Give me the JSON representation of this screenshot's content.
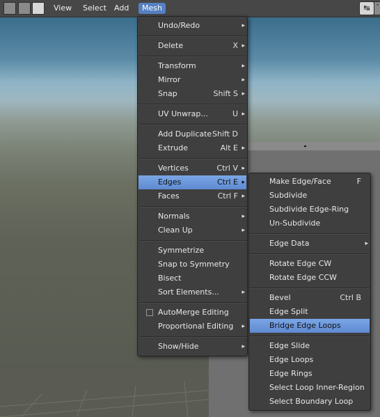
{
  "header": {
    "menus": [
      "View",
      "Select",
      "Add",
      "Mesh"
    ],
    "open_menu": "Mesh",
    "gizmo_icon": "transform-axes-icon",
    "accent_color": "#5680c2"
  },
  "mesh_menu": {
    "items": [
      {
        "label": "Undo/Redo",
        "shortcut": "",
        "submenu": true
      },
      {
        "label": "Delete",
        "shortcut": "X",
        "submenu": true
      },
      {
        "label": "Transform",
        "shortcut": "",
        "submenu": true
      },
      {
        "label": "Mirror",
        "shortcut": "",
        "submenu": true
      },
      {
        "label": "Snap",
        "shortcut": "Shift S",
        "submenu": true
      },
      {
        "label": "UV Unwrap...",
        "shortcut": "U",
        "submenu": true
      },
      {
        "label": "Add Duplicate",
        "shortcut": "Shift D",
        "submenu": false
      },
      {
        "label": "Extrude",
        "shortcut": "Alt E",
        "submenu": true
      },
      {
        "label": "Vertices",
        "shortcut": "Ctrl V",
        "submenu": true
      },
      {
        "label": "Edges",
        "shortcut": "Ctrl E",
        "submenu": true
      },
      {
        "label": "Faces",
        "shortcut": "Ctrl F",
        "submenu": true
      },
      {
        "label": "Normals",
        "shortcut": "",
        "submenu": true
      },
      {
        "label": "Clean Up",
        "shortcut": "",
        "submenu": true
      },
      {
        "label": "Symmetrize",
        "shortcut": "",
        "submenu": false
      },
      {
        "label": "Snap to Symmetry",
        "shortcut": "",
        "submenu": false
      },
      {
        "label": "Bisect",
        "shortcut": "",
        "submenu": false
      },
      {
        "label": "Sort Elements...",
        "shortcut": "",
        "submenu": true
      },
      {
        "label": "AutoMerge Editing",
        "shortcut": "",
        "submenu": false
      },
      {
        "label": "Proportional Editing",
        "shortcut": "",
        "submenu": true
      },
      {
        "label": "Show/Hide",
        "shortcut": "",
        "submenu": true
      }
    ],
    "highlighted": "Edges"
  },
  "edges_menu": {
    "items": [
      {
        "label": "Make Edge/Face",
        "shortcut": "F",
        "submenu": false
      },
      {
        "label": "Subdivide",
        "shortcut": "",
        "submenu": false
      },
      {
        "label": "Subdivide Edge-Ring",
        "shortcut": "",
        "submenu": false
      },
      {
        "label": "Un-Subdivide",
        "shortcut": "",
        "submenu": false
      },
      {
        "label": "Edge Data",
        "shortcut": "",
        "submenu": true
      },
      {
        "label": "Rotate Edge CW",
        "shortcut": "",
        "submenu": false
      },
      {
        "label": "Rotate Edge CCW",
        "shortcut": "",
        "submenu": false
      },
      {
        "label": "Bevel",
        "shortcut": "Ctrl B",
        "submenu": false
      },
      {
        "label": "Edge Split",
        "shortcut": "",
        "submenu": false
      },
      {
        "label": "Bridge Edge Loops",
        "shortcut": "",
        "submenu": false
      },
      {
        "label": "Edge Slide",
        "shortcut": "",
        "submenu": false
      },
      {
        "label": "Edge Loops",
        "shortcut": "",
        "submenu": false
      },
      {
        "label": "Edge Rings",
        "shortcut": "",
        "submenu": false
      },
      {
        "label": "Select Loop Inner-Region",
        "shortcut": "",
        "submenu": false
      },
      {
        "label": "Select Boundary Loop",
        "shortcut": "",
        "submenu": false
      }
    ],
    "highlighted": "Bridge Edge Loops"
  }
}
